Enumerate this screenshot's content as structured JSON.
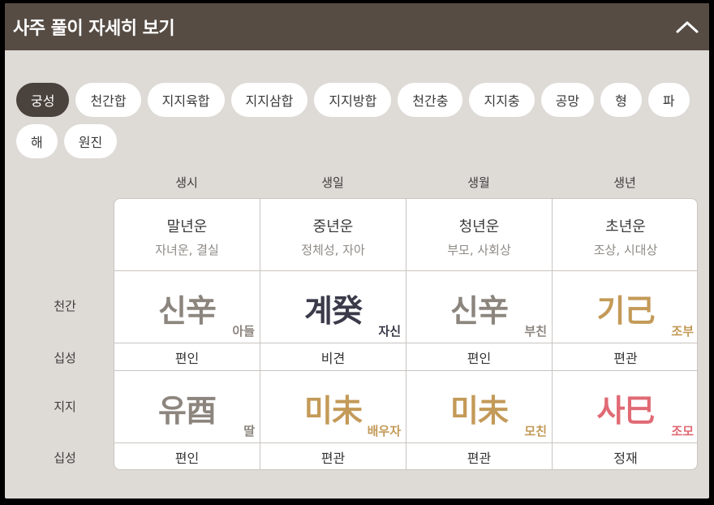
{
  "header": {
    "title": "사주 풀이 자세히 보기",
    "collapse_icon": "chevron-up-icon"
  },
  "tabs": [
    {
      "label": "궁성",
      "active": true
    },
    {
      "label": "천간합",
      "active": false
    },
    {
      "label": "지지육합",
      "active": false
    },
    {
      "label": "지지삼합",
      "active": false
    },
    {
      "label": "지지방합",
      "active": false
    },
    {
      "label": "천간충",
      "active": false
    },
    {
      "label": "지지충",
      "active": false
    },
    {
      "label": "공망",
      "active": false
    },
    {
      "label": "형",
      "active": false
    },
    {
      "label": "파",
      "active": false
    },
    {
      "label": "해",
      "active": false
    },
    {
      "label": "원진",
      "active": false
    }
  ],
  "columns": [
    {
      "header": "생시",
      "age": "말년운",
      "age_sub": "자녀운, 결실",
      "stem": "신辛",
      "stem_rel": "아들",
      "stem_color": "#8c857e",
      "stem_sipseong": "편인",
      "branch": "유酉",
      "branch_rel": "딸",
      "branch_color": "#8c857e",
      "branch_sipseong": "편인"
    },
    {
      "header": "생일",
      "age": "중년운",
      "age_sub": "정체성, 자아",
      "stem": "계癸",
      "stem_rel": "자신",
      "stem_color": "#3a3a4a",
      "stem_sipseong": "비견",
      "branch": "미未",
      "branch_rel": "배우자",
      "branch_color": "#c39a58",
      "branch_sipseong": "편관"
    },
    {
      "header": "생월",
      "age": "청년운",
      "age_sub": "부모, 사회상",
      "stem": "신辛",
      "stem_rel": "부친",
      "stem_color": "#8c857e",
      "stem_sipseong": "편인",
      "branch": "미未",
      "branch_rel": "모친",
      "branch_color": "#c39a58",
      "branch_sipseong": "편관"
    },
    {
      "header": "생년",
      "age": "초년운",
      "age_sub": "조상, 시대상",
      "stem": "기己",
      "stem_rel": "조부",
      "stem_color": "#c39a58",
      "stem_sipseong": "편관",
      "branch": "사巳",
      "branch_rel": "조모",
      "branch_color": "#e06a74",
      "branch_sipseong": "정재"
    }
  ],
  "row_labels": {
    "stem": "천간",
    "sipseong1": "십성",
    "branch": "지지",
    "sipseong2": "십성"
  },
  "colors": {
    "header_bg": "#564c44",
    "panel_bg": "#dedad6",
    "active_tab_bg": "#4a433d"
  }
}
